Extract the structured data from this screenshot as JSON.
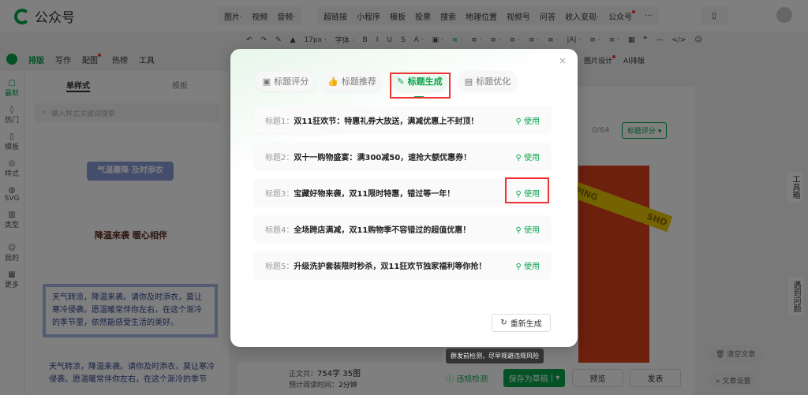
{
  "app": {
    "name": "公众号"
  },
  "top_menu": {
    "group1": [
      "图片·",
      "视频",
      "音频·"
    ],
    "group2": [
      "超链接",
      "小程序",
      "模板",
      "投票",
      "搜索",
      "地理位置",
      "视频号",
      "问答",
      "收入变现·",
      "公众号",
      "···"
    ]
  },
  "toolbar": {
    "items": [
      "↶",
      "↷",
      "✎",
      "▲",
      "17px ·",
      "字体 ·",
      "B",
      "I",
      "U",
      "S",
      "A ·",
      "▣ ·",
      "≡ ·",
      "≡ ·",
      "≡ ·",
      "≡ ·",
      "≡ ·",
      "≡ ·",
      "|A| ·",
      "≡ ·",
      "≡ ·",
      "▦",
      "❞",
      "—",
      "</>",
      "☺"
    ]
  },
  "plugin_tabs": [
    "排版",
    "写作",
    "配图",
    "热榜",
    "工具"
  ],
  "plugin_right": {
    "image_design": "图片设计",
    "ai_layout": "AI排版"
  },
  "side_nav": [
    "最新",
    "热门",
    "模板",
    "样式",
    "SVG",
    "类型",
    "我的",
    "更多"
  ],
  "left_panel": {
    "tabs": [
      "单样式",
      "模板"
    ],
    "search_placeholder": "输入样式关键词搜索",
    "sample1": "气温骤降 及时添衣",
    "sample2": "降温来袭 暖心相伴",
    "sample3": "天气转凉，降温来袭。请你及时添衣，莫让寒冷侵袭。愿温暖常伴你左右，在这个渐冷的季节里，依然能感受生活的美好。",
    "sample4": "天气转凉，降温来袭。请你及时添衣，莫让寒冷侵袭。愿温暖常伴你左右，在这个渐冷的季节"
  },
  "editor": {
    "title_count": "0/64",
    "title_score_btn": "标题评分",
    "poster_text1": "PPING",
    "poster_text2": "SHO"
  },
  "modal": {
    "close": "×",
    "tabs": [
      {
        "label": "标题评分",
        "icon": "▣"
      },
      {
        "label": "标题推荐",
        "icon": "👍"
      },
      {
        "label": "标题生成",
        "icon": "✎"
      },
      {
        "label": "标题优化",
        "icon": "▤"
      }
    ],
    "active_tab": "标题生成",
    "titles": [
      {
        "label": "标题1：",
        "text": "双11狂欢节：特惠礼券大放送，满减优惠上不封顶！"
      },
      {
        "label": "标题2：",
        "text": "双十一购物盛宴：满300减50，速抢大额优惠券！"
      },
      {
        "label": "标题3：",
        "text": "宝藏好物来袭，双11限时特惠，错过等一年！"
      },
      {
        "label": "标题4：",
        "text": "全场跨店满减，双11购物季不容错过的超值优惠！"
      },
      {
        "label": "标题5：",
        "text": "升级洗护套装限时秒杀，双11狂欢节独家福利等你抢！"
      }
    ],
    "use_label": "使用",
    "regenerate": "重新生成"
  },
  "footer": {
    "word_count_label": "正文共：",
    "word_count": "754字 35图",
    "read_time_label": "预计阅读时间：",
    "read_time": "2分钟",
    "check": "违规检测",
    "tooltip": "群发前检测，尽早规避违规风险",
    "save_draft": "保存为草稿",
    "preview": "预览",
    "publish": "发表"
  },
  "right_float": {
    "toolbox": "工具箱",
    "help": "遇到问题",
    "clear": "清空文章",
    "settings": "文章设置"
  },
  "colors": {
    "accent": "#07a44a",
    "highlight": "#e33333"
  }
}
